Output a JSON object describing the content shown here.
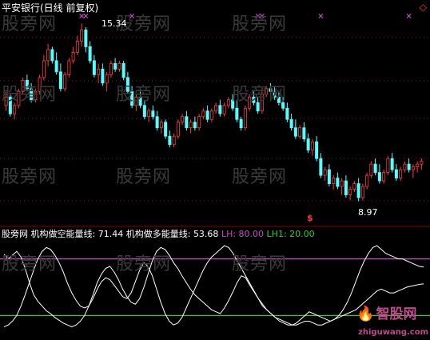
{
  "main_chart": {
    "title": "平安银行(日线 前复权)",
    "high_label": "15.34",
    "low_label": "8.97",
    "signal_glyph": "$",
    "corner_glyph": "◇"
  },
  "indicator": {
    "name": "股旁网",
    "series1_label": "机构做空能量线:",
    "series1_value": "71.44",
    "series2_label": "机构做多能量线:",
    "series2_value": "53.68",
    "lh_label": "LH:",
    "lh_value": "80.00",
    "lh1_label": "LH1:",
    "lh1_value": "20.00"
  },
  "watermarks": [
    "股旁网",
    "股旁网",
    "股旁网",
    "股旁网",
    "股旁网",
    "股旁网",
    "股旁网",
    "股旁网",
    "股旁网",
    "股旁网",
    "股旁网",
    "股旁网"
  ],
  "logo": {
    "text": "智股网",
    "site": "zhiguwang.com"
  },
  "colors": {
    "up": "#ff3c3c",
    "down": "#54ffff",
    "dot_line": "#ff3030",
    "text_red": "#ff3c3c",
    "text_white": "#ffffff",
    "lh": "#c04fc0",
    "lh1": "#33cc33",
    "series": "#ffffff",
    "marker": "#cc44cc"
  },
  "chart_data": {
    "type": "candlestick",
    "ylim": [
      8.5,
      15.6
    ],
    "candles": [
      [
        12.4,
        12.9,
        12.2,
        12.7
      ],
      [
        12.7,
        12.8,
        12.0,
        12.1
      ],
      [
        12.1,
        12.5,
        11.9,
        12.4
      ],
      [
        12.4,
        13.0,
        12.3,
        12.9
      ],
      [
        12.9,
        13.4,
        12.8,
        13.3
      ],
      [
        13.3,
        13.5,
        12.9,
        13.0
      ],
      [
        13.0,
        13.2,
        12.5,
        12.6
      ],
      [
        12.6,
        13.0,
        12.5,
        12.9
      ],
      [
        12.9,
        13.5,
        12.8,
        13.4
      ],
      [
        13.4,
        14.2,
        13.3,
        14.0
      ],
      [
        14.0,
        14.6,
        13.8,
        14.4
      ],
      [
        14.4,
        14.5,
        13.9,
        14.0
      ],
      [
        14.0,
        14.3,
        13.5,
        13.6
      ],
      [
        13.6,
        13.9,
        12.9,
        13.0
      ],
      [
        13.0,
        13.6,
        12.9,
        13.5
      ],
      [
        13.5,
        14.1,
        13.4,
        14.0
      ],
      [
        14.0,
        14.5,
        13.9,
        14.3
      ],
      [
        14.3,
        14.9,
        14.2,
        14.7
      ],
      [
        14.7,
        15.34,
        14.5,
        15.1
      ],
      [
        15.1,
        15.2,
        14.3,
        14.5
      ],
      [
        14.5,
        14.7,
        13.9,
        14.0
      ],
      [
        14.0,
        14.2,
        13.4,
        13.5
      ],
      [
        13.5,
        13.9,
        13.2,
        13.7
      ],
      [
        13.7,
        13.9,
        13.1,
        13.2
      ],
      [
        13.2,
        13.6,
        12.9,
        13.5
      ],
      [
        13.5,
        14.0,
        13.4,
        13.9
      ],
      [
        13.9,
        14.1,
        13.6,
        13.7
      ],
      [
        13.7,
        14.0,
        13.6,
        13.9
      ],
      [
        13.9,
        14.0,
        13.3,
        13.4
      ],
      [
        13.4,
        13.6,
        12.8,
        12.9
      ],
      [
        12.9,
        13.1,
        12.3,
        12.4
      ],
      [
        12.4,
        12.8,
        12.2,
        12.7
      ],
      [
        12.7,
        12.9,
        12.3,
        12.4
      ],
      [
        12.4,
        12.6,
        11.9,
        12.0
      ],
      [
        12.0,
        12.3,
        11.8,
        12.2
      ],
      [
        12.2,
        12.4,
        11.9,
        12.0
      ],
      [
        12.0,
        12.2,
        11.5,
        11.6
      ],
      [
        11.6,
        11.9,
        11.4,
        11.8
      ],
      [
        11.8,
        11.9,
        11.2,
        11.3
      ],
      [
        11.3,
        11.5,
        10.9,
        11.0
      ],
      [
        11.0,
        11.4,
        10.9,
        11.3
      ],
      [
        11.3,
        11.9,
        11.2,
        11.8
      ],
      [
        11.8,
        12.1,
        11.7,
        12.0
      ],
      [
        12.0,
        12.2,
        11.5,
        11.6
      ],
      [
        11.6,
        11.9,
        11.4,
        11.8
      ],
      [
        11.8,
        12.0,
        11.5,
        11.6
      ],
      [
        11.6,
        12.1,
        11.5,
        12.0
      ],
      [
        12.0,
        12.3,
        11.9,
        12.2
      ],
      [
        12.2,
        12.4,
        11.8,
        11.9
      ],
      [
        11.9,
        12.3,
        11.8,
        12.2
      ],
      [
        12.2,
        12.5,
        12.1,
        12.4
      ],
      [
        12.4,
        12.6,
        12.0,
        12.1
      ],
      [
        12.1,
        12.5,
        12.0,
        12.4
      ],
      [
        12.4,
        12.7,
        12.3,
        12.6
      ],
      [
        12.6,
        12.8,
        12.2,
        12.3
      ],
      [
        12.3,
        12.6,
        11.8,
        11.9
      ],
      [
        11.9,
        12.0,
        11.5,
        11.6
      ],
      [
        11.6,
        12.4,
        11.5,
        12.3
      ],
      [
        12.3,
        12.8,
        12.2,
        12.7
      ],
      [
        12.7,
        12.9,
        12.4,
        12.5
      ],
      [
        12.5,
        12.7,
        12.1,
        12.2
      ],
      [
        12.2,
        12.9,
        12.1,
        12.8
      ],
      [
        12.8,
        13.1,
        12.7,
        13.0
      ],
      [
        13.0,
        13.2,
        12.8,
        12.9
      ],
      [
        12.9,
        13.1,
        12.6,
        12.7
      ],
      [
        12.7,
        12.9,
        12.4,
        12.5
      ],
      [
        12.5,
        12.7,
        12.2,
        12.3
      ],
      [
        12.3,
        12.5,
        11.8,
        11.9
      ],
      [
        11.9,
        12.1,
        11.5,
        11.6
      ],
      [
        11.6,
        11.9,
        11.2,
        11.3
      ],
      [
        11.3,
        11.7,
        11.2,
        11.6
      ],
      [
        11.6,
        11.8,
        11.1,
        11.2
      ],
      [
        11.2,
        11.4,
        10.7,
        10.8
      ],
      [
        10.8,
        11.2,
        10.6,
        11.1
      ],
      [
        11.1,
        11.3,
        10.4,
        10.5
      ],
      [
        10.5,
        10.7,
        9.8,
        9.9
      ],
      [
        9.9,
        10.2,
        9.7,
        10.1
      ],
      [
        10.1,
        10.3,
        9.5,
        9.6
      ],
      [
        9.6,
        9.9,
        9.4,
        9.8
      ],
      [
        9.8,
        10.0,
        9.4,
        9.5
      ],
      [
        9.5,
        9.8,
        9.2,
        9.7
      ],
      [
        9.7,
        9.9,
        9.1,
        9.2
      ],
      [
        9.2,
        9.5,
        9.0,
        9.4
      ],
      [
        9.4,
        9.7,
        9.3,
        9.6
      ],
      [
        9.6,
        9.8,
        8.97,
        9.1
      ],
      [
        9.1,
        9.6,
        9.0,
        9.5
      ],
      [
        9.5,
        10.0,
        9.4,
        9.9
      ],
      [
        9.9,
        10.4,
        9.8,
        10.3
      ],
      [
        10.3,
        10.5,
        9.9,
        10.0
      ],
      [
        10.0,
        10.3,
        9.6,
        9.7
      ],
      [
        9.7,
        10.1,
        9.6,
        10.0
      ],
      [
        10.0,
        10.6,
        9.9,
        10.5
      ],
      [
        10.5,
        10.7,
        10.0,
        10.1
      ],
      [
        10.1,
        10.3,
        9.7,
        9.8
      ],
      [
        9.8,
        10.2,
        9.7,
        10.1
      ],
      [
        10.1,
        10.4,
        10.0,
        10.3
      ],
      [
        10.3,
        10.5,
        10.0,
        10.1
      ],
      [
        10.1,
        10.3,
        9.8,
        10.2
      ],
      [
        10.2,
        10.4,
        10.0,
        10.3
      ],
      [
        10.3,
        10.5,
        10.1,
        10.4
      ]
    ],
    "markers_top": [
      18,
      19,
      30,
      60,
      61,
      75,
      96
    ],
    "signal_index": 75,
    "indicator": {
      "ylim": [
        0,
        100
      ],
      "lh": 80,
      "lh1": 20,
      "short_energy": [
        85,
        80,
        84,
        88,
        82,
        70,
        55,
        42,
        35,
        30,
        25,
        22,
        18,
        15,
        12,
        10,
        8,
        10,
        14,
        20,
        30,
        42,
        55,
        64,
        70,
        72,
        66,
        58,
        48,
        40,
        34,
        32,
        38,
        50,
        64,
        78,
        88,
        92,
        90,
        84,
        76,
        70,
        62,
        55,
        48,
        42,
        38,
        34,
        30,
        26,
        24,
        22,
        28,
        36,
        45,
        55,
        62,
        60,
        52,
        45,
        38,
        30,
        26,
        22,
        18,
        14,
        12,
        10,
        10,
        12,
        16,
        20,
        24,
        22,
        20,
        18,
        16,
        14,
        16,
        20,
        26,
        34,
        44,
        56,
        68,
        78,
        86,
        92,
        94,
        90,
        86,
        84,
        82,
        80,
        80,
        78,
        76,
        74,
        72,
        71.44
      ],
      "long_energy": [
        8,
        10,
        14,
        20,
        30,
        42,
        55,
        68,
        80,
        88,
        92,
        90,
        84,
        76,
        66,
        54,
        44,
        36,
        30,
        28,
        30,
        38,
        48,
        56,
        60,
        58,
        52,
        46,
        40,
        38,
        44,
        56,
        68,
        76,
        72,
        62,
        48,
        34,
        22,
        14,
        10,
        12,
        18,
        28,
        38,
        48,
        58,
        68,
        76,
        82,
        86,
        90,
        94,
        92,
        86,
        78,
        70,
        62,
        54,
        46,
        38,
        32,
        26,
        22,
        18,
        16,
        14,
        12,
        10,
        10,
        12,
        14,
        14,
        12,
        10,
        10,
        12,
        14,
        16,
        18,
        20,
        22,
        24,
        26,
        30,
        34,
        38,
        42,
        46,
        48,
        46,
        44,
        44,
        46,
        48,
        50,
        51,
        52,
        53,
        53.68
      ]
    }
  }
}
